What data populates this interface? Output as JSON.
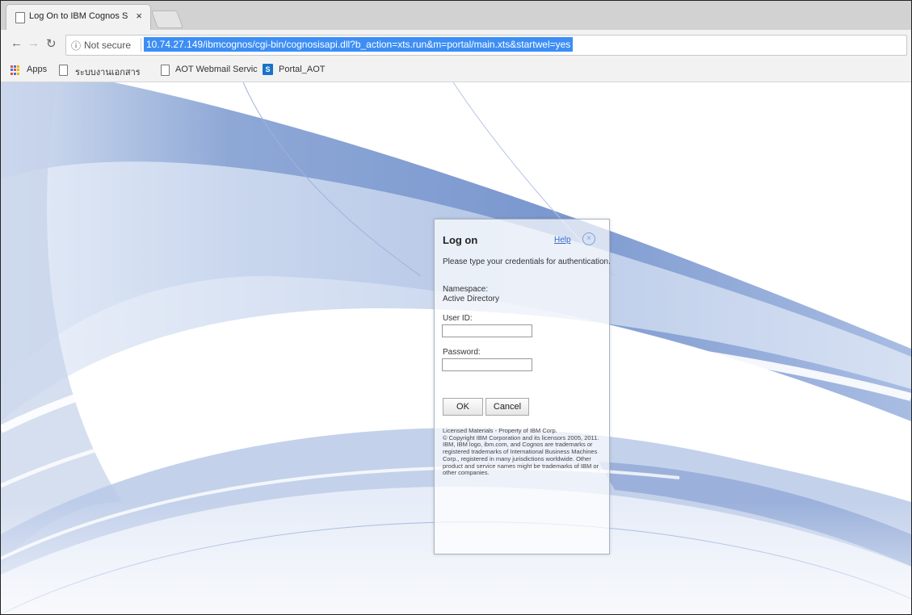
{
  "browser": {
    "tab_title": "Log On to IBM Cognos S",
    "tab_close": "×",
    "url_security": "Not secure",
    "url": "10.74.27.149/ibmcognos/cgi-bin/cognosisapi.dll?b_action=xts.run&m=portal/main.xts&startwel=yes",
    "bookmarks": {
      "apps": "Apps",
      "item1": "ระบบงานเอกสารอเล็กท",
      "item2": "AOT Webmail Servic",
      "item3": "Portal_AOT",
      "item3_icon_letter": "S"
    }
  },
  "login": {
    "title": "Log on",
    "help": "Help",
    "close_glyph": "×",
    "instructions": "Please type your credentials for authentication.",
    "namespace_label": "Namespace:",
    "namespace_value": "Active Directory",
    "userid_label": "User ID:",
    "userid_value": "",
    "password_label": "Password:",
    "password_value": "",
    "ok_label": "OK",
    "cancel_label": "Cancel",
    "legal": "Licensed Materials - Property of IBM Corp.\n© Copyright IBM Corporation and its licensors 2005, 2011.\nIBM, IBM logo, ibm.com, and Cognos are trademarks or registered trademarks of International Business Machines Corp., registered in many jurisdictions worldwide. Other product and service names might be trademarks of IBM or other companies."
  },
  "colors": {
    "url_highlight": "#3c8ef5",
    "link": "#3266c8",
    "swoosh_dark": "#6f8fc7",
    "swoosh_light": "#c9d7ee"
  }
}
